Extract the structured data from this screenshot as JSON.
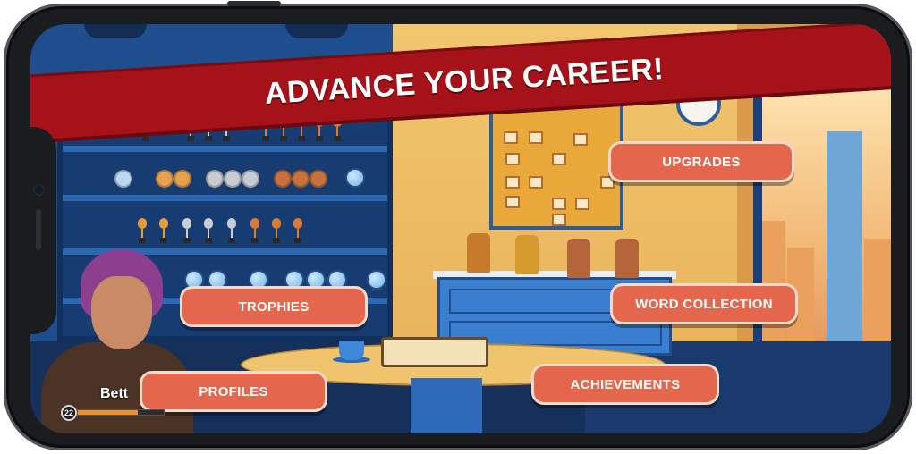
{
  "banner": {
    "title": "ADVANCE YOUR CAREER!"
  },
  "menu": {
    "upgrades": "UPGRADES",
    "trophies": "TROPHIES",
    "word_collection": "WORD COLLECTION",
    "profiles": "PROFILES",
    "achievements": "ACHIEVEMENTS"
  },
  "player": {
    "name": "Bett",
    "level": "22",
    "xp_progress": 0.7
  },
  "colors": {
    "banner": "#a5121a",
    "button": "#e4674d",
    "button_border": "#f9d9c7",
    "xp_bar": "#f0902d"
  }
}
